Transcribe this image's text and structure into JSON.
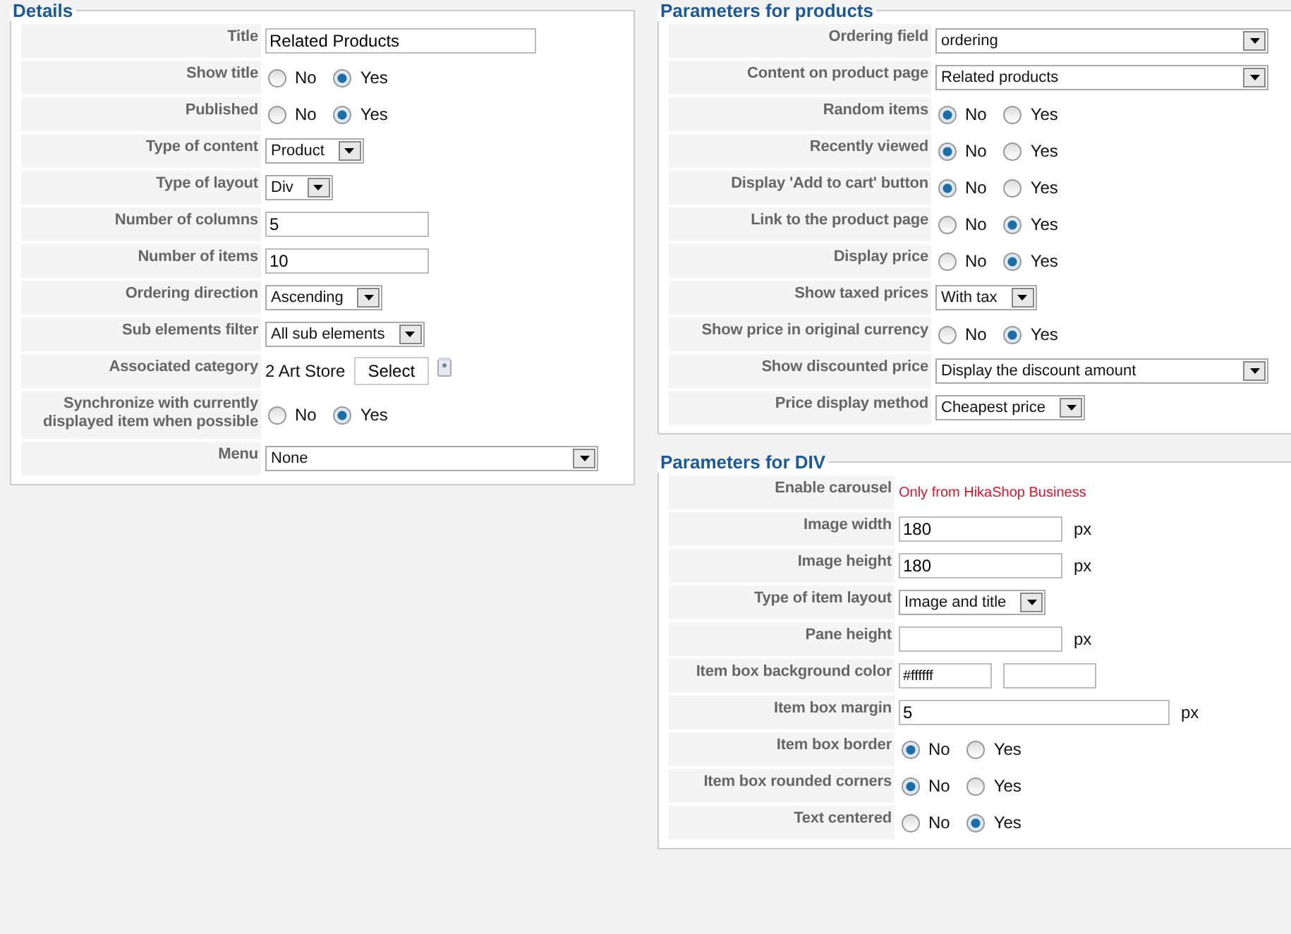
{
  "sections": [
    {
      "title": "Details",
      "rows": [
        {
          "label": "Title",
          "kind": "text",
          "value": "Related Products",
          "wide": true
        },
        {
          "label": "Show title",
          "kind": "radio",
          "options": [
            {
              "label": "No",
              "selected": false
            },
            {
              "label": "Yes",
              "selected": true
            }
          ]
        },
        {
          "label": "Published",
          "kind": "radio",
          "options": [
            {
              "label": "No",
              "selected": false
            },
            {
              "label": "Yes",
              "selected": true
            }
          ]
        },
        {
          "label": "Type of content",
          "kind": "select",
          "value": "Product"
        },
        {
          "label": "Type of layout",
          "kind": "select",
          "value": "Div"
        },
        {
          "label": "Number of columns",
          "kind": "text",
          "value": "5"
        },
        {
          "label": "Number of items",
          "kind": "text",
          "value": "10"
        },
        {
          "label": "Ordering direction",
          "kind": "select",
          "value": "Ascending"
        },
        {
          "label": "Sub elements filter",
          "kind": "select",
          "value": "All sub elements"
        },
        {
          "label": "Associated category",
          "kind": "category",
          "value": "2 Art Store",
          "button": "Select"
        },
        {
          "label": "Synchronize with currently displayed item when possible",
          "kind": "radio",
          "options": [
            {
              "label": "No",
              "selected": false
            },
            {
              "label": "Yes",
              "selected": true
            }
          ]
        },
        {
          "label": "Menu",
          "kind": "select",
          "value": "None",
          "wide": true
        }
      ]
    },
    {
      "title": "Parameters for products",
      "rows": [
        {
          "label": "Ordering field",
          "kind": "select",
          "value": "ordering",
          "wide": true
        },
        {
          "label": "Content on product page",
          "kind": "select",
          "value": "Related products",
          "wide": true
        },
        {
          "label": "Random items",
          "kind": "radio",
          "options": [
            {
              "label": "No",
              "selected": true
            },
            {
              "label": "Yes",
              "selected": false
            }
          ]
        },
        {
          "label": "Recently viewed",
          "kind": "radio",
          "options": [
            {
              "label": "No",
              "selected": true
            },
            {
              "label": "Yes",
              "selected": false
            }
          ]
        },
        {
          "label": "Display 'Add to cart' button",
          "kind": "radio",
          "options": [
            {
              "label": "No",
              "selected": true
            },
            {
              "label": "Yes",
              "selected": false
            }
          ]
        },
        {
          "label": "Link to the product page",
          "kind": "radio",
          "options": [
            {
              "label": "No",
              "selected": false
            },
            {
              "label": "Yes",
              "selected": true
            }
          ]
        },
        {
          "label": "Display price",
          "kind": "radio",
          "options": [
            {
              "label": "No",
              "selected": false
            },
            {
              "label": "Yes",
              "selected": true
            }
          ]
        },
        {
          "label": "Show taxed prices",
          "kind": "select",
          "value": "With tax"
        },
        {
          "label": "Show price in original currency",
          "kind": "radio",
          "options": [
            {
              "label": "No",
              "selected": false
            },
            {
              "label": "Yes",
              "selected": true
            }
          ]
        },
        {
          "label": "Show discounted price",
          "kind": "select",
          "value": "Display the discount amount",
          "wide": true
        },
        {
          "label": "Price display method",
          "kind": "select",
          "value": "Cheapest price"
        }
      ]
    },
    {
      "title": "Parameters for DIV",
      "rows": [
        {
          "label": "Enable carousel",
          "kind": "note",
          "value": "Only from HikaShop Business"
        },
        {
          "label": "Image width",
          "kind": "text",
          "value": "180",
          "unit": "px"
        },
        {
          "label": "Image height",
          "kind": "text",
          "value": "180",
          "unit": "px"
        },
        {
          "label": "Type of item layout",
          "kind": "select",
          "value": "Image and title"
        },
        {
          "label": "Pane height",
          "kind": "text",
          "unit": "px"
        },
        {
          "label": "Item box background color",
          "kind": "color",
          "value": "#ffffff"
        },
        {
          "label": "Item box margin",
          "kind": "text",
          "value": "5",
          "unit": "px",
          "wide": true
        },
        {
          "label": "Item box border",
          "kind": "radio",
          "options": [
            {
              "label": "No",
              "selected": true
            },
            {
              "label": "Yes",
              "selected": false
            }
          ]
        },
        {
          "label": "Item box rounded corners",
          "kind": "radio",
          "options": [
            {
              "label": "No",
              "selected": true
            },
            {
              "label": "Yes",
              "selected": false
            }
          ]
        },
        {
          "label": "Text centered",
          "kind": "radio",
          "options": [
            {
              "label": "No",
              "selected": false
            },
            {
              "label": "Yes",
              "selected": true
            }
          ]
        }
      ]
    }
  ]
}
